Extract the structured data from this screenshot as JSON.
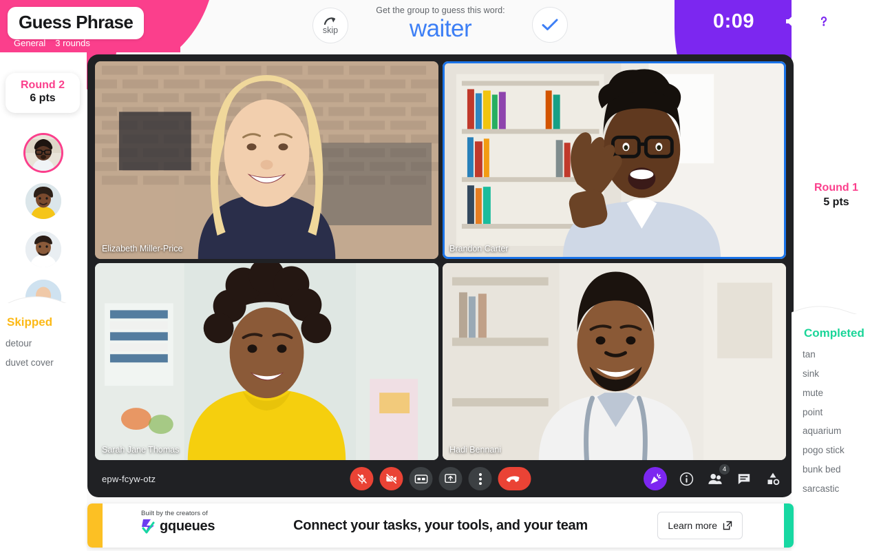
{
  "game": {
    "title": "Guess Phrase",
    "category": "General",
    "rounds_label": "3 rounds",
    "prompt": "Get the group to guess this word:",
    "current_word": "waiter",
    "skip_label": "skip",
    "timer": "0:09",
    "accent_pink": "#fb3f8c",
    "accent_purple": "#7c27f0",
    "accent_yellow": "#fcb916",
    "accent_green": "#1ad598",
    "word_color": "#3d7ff5"
  },
  "left_panel": {
    "round_title": "Round 2",
    "round_points": "6 pts",
    "skipped_title": "Skipped",
    "skipped_words": [
      "detour",
      "duvet cover"
    ],
    "players": [
      {
        "name": "Brandon Carter",
        "active": true
      },
      {
        "name": "Sarah Jane Thomas",
        "active": false
      },
      {
        "name": "Hadi Bennani",
        "active": false
      },
      {
        "name": "Elizabeth Miller-Price",
        "active": false
      }
    ]
  },
  "right_panel": {
    "round_title": "Round 1",
    "round_points": "5 pts",
    "completed_title": "Completed",
    "completed_words": [
      "tan",
      "sink",
      "mute",
      "point",
      "aquarium",
      "pogo stick",
      "bunk bed",
      "sarcastic"
    ]
  },
  "meet": {
    "code": "epw-fcyw-otz",
    "participant_count": "4",
    "tiles": [
      {
        "name": "Elizabeth Miller-Price",
        "speaking": false
      },
      {
        "name": "Brandon Carter",
        "speaking": true
      },
      {
        "name": "Sarah Jane Thomas",
        "speaking": false
      },
      {
        "name": "Hadi Bennani",
        "speaking": false
      }
    ],
    "controls": [
      {
        "icon": "microphone-muted-icon",
        "state": "muted"
      },
      {
        "icon": "camera-off-icon",
        "state": "off"
      },
      {
        "icon": "closed-captions-icon",
        "state": "normal"
      },
      {
        "icon": "present-screen-icon",
        "state": "normal"
      },
      {
        "icon": "more-options-icon",
        "state": "normal"
      },
      {
        "icon": "hang-up-icon",
        "state": "danger"
      }
    ],
    "right_controls": [
      {
        "icon": "activities-confetti-icon"
      },
      {
        "icon": "meeting-info-icon"
      },
      {
        "icon": "people-icon"
      },
      {
        "icon": "chat-icon"
      },
      {
        "icon": "activities-shapes-icon"
      }
    ]
  },
  "banner": {
    "built_by": "Built by the creators of",
    "brand": "gqueues",
    "headline": "Connect your tasks, your tools, and your team",
    "cta": "Learn more"
  },
  "topbar_icons": [
    {
      "name": "volume-icon"
    },
    {
      "name": "help-icon"
    },
    {
      "name": "close-icon"
    }
  ]
}
